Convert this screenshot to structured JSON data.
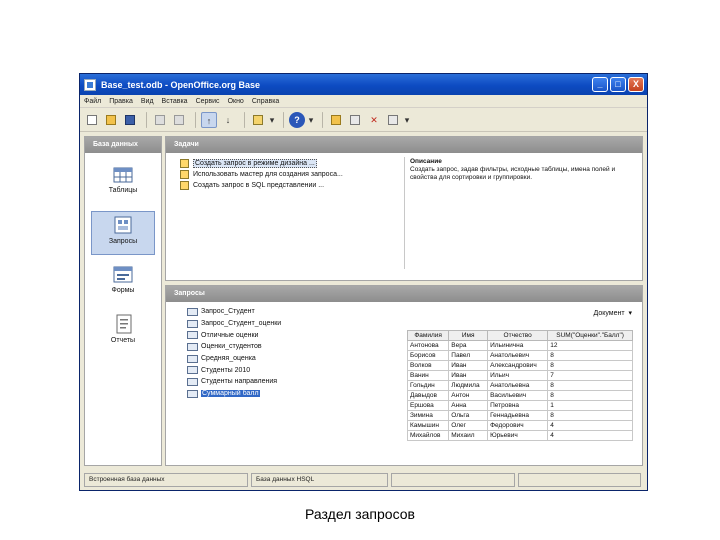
{
  "window": {
    "title": "Base_test.odb - OpenOffice.org Base",
    "buttons": [
      "_",
      "□",
      "X"
    ]
  },
  "menubar": [
    "Файл",
    "Правка",
    "Вид",
    "Вставка",
    "Сервис",
    "Окно",
    "Справка"
  ],
  "toolbar": {
    "icons": [
      "new-icon",
      "open-icon",
      "save-icon",
      "cut-icon",
      "paste-icon",
      "sort-asc-icon",
      "sort-desc-icon",
      "form-icon",
      "help-icon",
      "open-object-icon",
      "edit-icon",
      "delete-icon",
      "rename-icon"
    ]
  },
  "db_panel": {
    "header": "База данных",
    "items": [
      {
        "label": "Таблицы",
        "icon": "tables-icon"
      },
      {
        "label": "Запросы",
        "icon": "queries-icon"
      },
      {
        "label": "Формы",
        "icon": "forms-icon"
      },
      {
        "label": "Отчеты",
        "icon": "reports-icon"
      }
    ]
  },
  "tasks": {
    "header": "Задачи",
    "items": [
      "Создать запрос в режиме дизайна ...",
      "Использовать мастер для создания запроса...",
      "Создать запрос в SQL представлении ..."
    ],
    "description": {
      "heading": "Описание",
      "text": "Создать запрос, задав фильтры, исходные таблицы, имена полей и свойства для сортировки и группировки."
    }
  },
  "queries": {
    "header": "Запросы",
    "items": [
      "Запрос_Студент",
      "Запрос_Студент_оценки",
      "Отличные оценки",
      "Оценки_студентов",
      "Средняя_оценка",
      "Студенты 2010",
      "Студенты направления",
      "Суммарный балл"
    ],
    "document_label": "Документ"
  },
  "preview": {
    "columns": [
      "Фамилия",
      "Имя",
      "Отчество",
      "SUM(\"Оценки\".\"Балл\")"
    ],
    "rows": [
      [
        "Антонова",
        "Вера",
        "Ильинична",
        "12"
      ],
      [
        "Борисов",
        "Павел",
        "Анатольевич",
        "8"
      ],
      [
        "Волков",
        "Иван",
        "Александрович",
        "8"
      ],
      [
        "Ванин",
        "Иван",
        "Ильич",
        "7"
      ],
      [
        "Гольдин",
        "Людмила",
        "Анатольевна",
        "8"
      ],
      [
        "Давыдов",
        "Антон",
        "Васильевич",
        "8"
      ],
      [
        "Ершова",
        "Анна",
        "Петровна",
        "1"
      ],
      [
        "Зимина",
        "Ольга",
        "Геннадьевна",
        "8"
      ],
      [
        "Камышин",
        "Олег",
        "Федорович",
        "4"
      ],
      [
        "Михайлов",
        "Михаил",
        "Юрьевич",
        "4"
      ]
    ]
  },
  "statusbar": [
    "Встроенная база данных",
    "База данных HSQL",
    "",
    ""
  ],
  "caption": "Раздел запросов"
}
